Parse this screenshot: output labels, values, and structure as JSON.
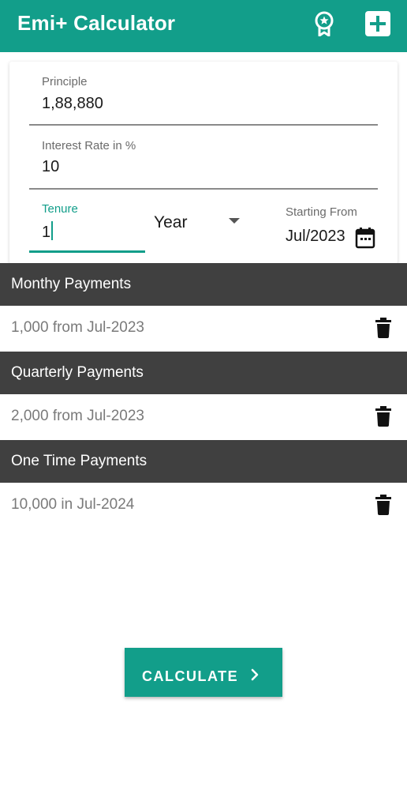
{
  "app_bar": {
    "title": "Emi+ Calculator",
    "icons": [
      "award-badge-icon",
      "add-box-icon"
    ],
    "color": "#129e8a"
  },
  "form": {
    "principle": {
      "label": "Principle",
      "value": "1,88,880"
    },
    "interest_rate": {
      "label": "Interest Rate in %",
      "value": "10"
    },
    "tenure": {
      "label": "Tenure",
      "value": "1"
    },
    "tenure_unit": {
      "selected": "Year"
    },
    "starting_from": {
      "label": "Starting From",
      "value": "Jul/2023"
    }
  },
  "sections": [
    {
      "header": "Monthy Payments",
      "rows": [
        {
          "text": "1,000 from Jul-2023"
        }
      ]
    },
    {
      "header": "Quarterly Payments",
      "rows": [
        {
          "text": "2,000 from Jul-2023"
        }
      ]
    },
    {
      "header": "One Time Payments",
      "rows": [
        {
          "text": "10,000 in Jul-2024"
        }
      ]
    }
  ],
  "calculate_button": {
    "label": "CALCULATE",
    "icon": "chevron-right-icon"
  },
  "colors": {
    "accent": "#129e8a",
    "section_header": "#404040"
  }
}
